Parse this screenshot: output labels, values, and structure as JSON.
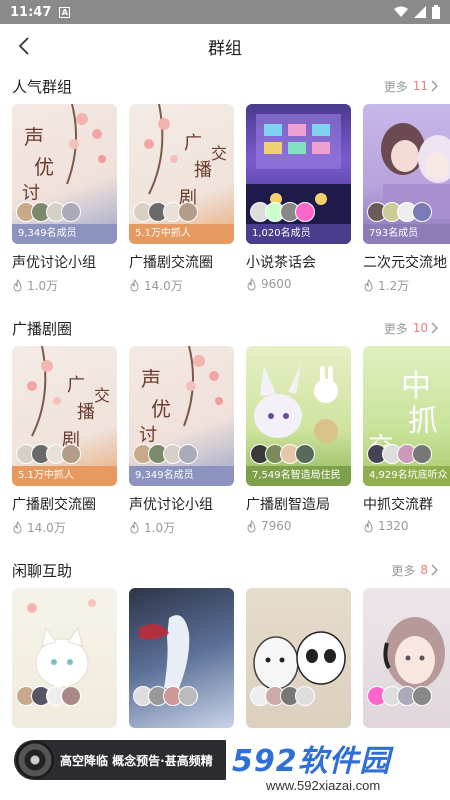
{
  "status_bar": {
    "time": "11:47",
    "notif_icon": "A"
  },
  "header": {
    "title": "群组",
    "back_icon": "chevron-left-icon"
  },
  "sections": [
    {
      "title": "人气群组",
      "more_label": "更多",
      "more_count": "11",
      "cards": [
        {
          "name": "声优讨论小组",
          "members": "9,349名成员",
          "hot": "1.0万"
        },
        {
          "name": "广播剧交流圈",
          "members": "5.1万中抓人",
          "hot": "14.0万"
        },
        {
          "name": "小说茶话会",
          "members": "1,020名成员",
          "hot": "9600"
        },
        {
          "name": "二次元交流地",
          "members": "793名成员",
          "hot": "1.2万"
        }
      ]
    },
    {
      "title": "广播剧圈",
      "more_label": "更多",
      "more_count": "10",
      "cards": [
        {
          "name": "广播剧交流圈",
          "members": "5.1万中抓人",
          "hot": "14.0万"
        },
        {
          "name": "声优讨论小组",
          "members": "9,349名成员",
          "hot": "1.0万"
        },
        {
          "name": "广播剧智造局",
          "members": "7,549名智造局住民",
          "hot": "7960"
        },
        {
          "name": "中抓交流群",
          "members": "4,929名坑底听众",
          "hot": "1320"
        }
      ]
    },
    {
      "title": "闲聊互助",
      "more_label": "更多",
      "more_count": "8",
      "cards": [
        {
          "name": ""
        },
        {
          "name": ""
        },
        {
          "name": ""
        },
        {
          "name": ""
        }
      ]
    }
  ],
  "art_text": {
    "a": "声优讨论",
    "b": "广播剧交流",
    "c": "中抓交"
  },
  "float_player": {
    "text": "高空降临 概念预告·甚高频精"
  },
  "watermark": {
    "logo": "592软件园",
    "url": "www.592xiazai.com"
  },
  "colors": {
    "accent": "#f07a7a",
    "muted": "#999999",
    "watermark_blue": "#2f6fd8"
  }
}
